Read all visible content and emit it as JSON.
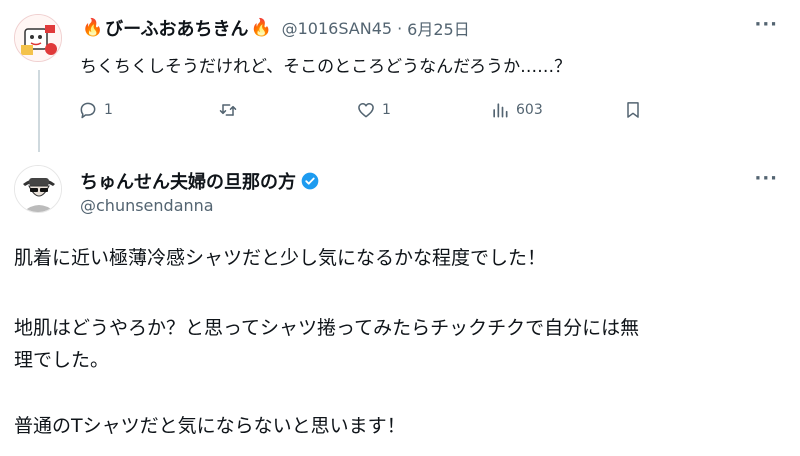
{
  "reply_tweet": {
    "display_name": "びーふおあちきん",
    "handle": "@1016SAN45",
    "separator": "·",
    "date": "6月25日",
    "text": "ちくちくしそうだけれど、そこのところどうなんだろうか……？",
    "more": "···",
    "actions": {
      "reply_count": "1",
      "retweet_count": "",
      "like_count": "1",
      "view_count": "603"
    }
  },
  "main_tweet": {
    "display_name": "ちゅんせん夫婦の旦那の方",
    "handle": "@chunsendanna",
    "more": "···",
    "lines": [
      "肌着に近い極薄冷感シャツだと少し気になるかな程度でした！",
      "地肌はどうやろか？と思ってシャツ捲ってみたらチックチクで自分には無",
      "理でした。",
      "普通のTシャツだと気にならないと思います！"
    ]
  },
  "colors": {
    "text": "#0f1419",
    "muted": "#536471",
    "verified": "#1d9bf0",
    "fire": "#f26a1b",
    "thread_line": "#cfd9de"
  },
  "icons": {
    "reply": "reply-icon",
    "retweet": "retweet-icon",
    "like": "heart-icon",
    "views": "views-icon",
    "bookmark": "bookmark-icon",
    "verified": "verified-badge-icon",
    "fire": "fire-emoji-icon"
  }
}
